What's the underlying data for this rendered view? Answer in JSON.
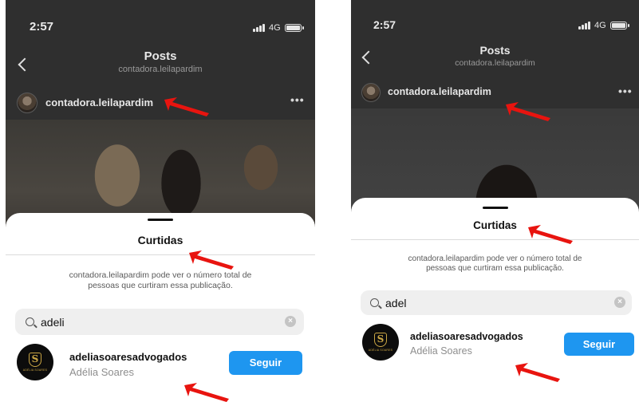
{
  "status_bar": {
    "time": "2:57",
    "network": "4G"
  },
  "header": {
    "title": "Posts",
    "subtitle": "contadora.leilapardim"
  },
  "post": {
    "username": "contadora.leilapardim",
    "more": "•••"
  },
  "likes_sheet": {
    "title": "Curtidas",
    "description_line1": "contadora.leilapardim pode ver o número total de",
    "description_line2": "pessoas que curtiram essa publicação."
  },
  "left_panel": {
    "search_value": "adeli"
  },
  "right_panel": {
    "search_value": "adel"
  },
  "result": {
    "username": "adeliasoaresadvogados",
    "full_name": "Adélia Soares",
    "follow_label": "Seguir",
    "logo_letter": "S",
    "logo_text": "ADÉLIA SOARES"
  },
  "colors": {
    "accent": "#1e96f0",
    "annotation_arrow": "#e8140f",
    "overlay": "#2f2f2f"
  },
  "icons": [
    "back-icon",
    "more-icon",
    "search-icon",
    "clear-icon",
    "signal-icon",
    "battery-icon"
  ]
}
